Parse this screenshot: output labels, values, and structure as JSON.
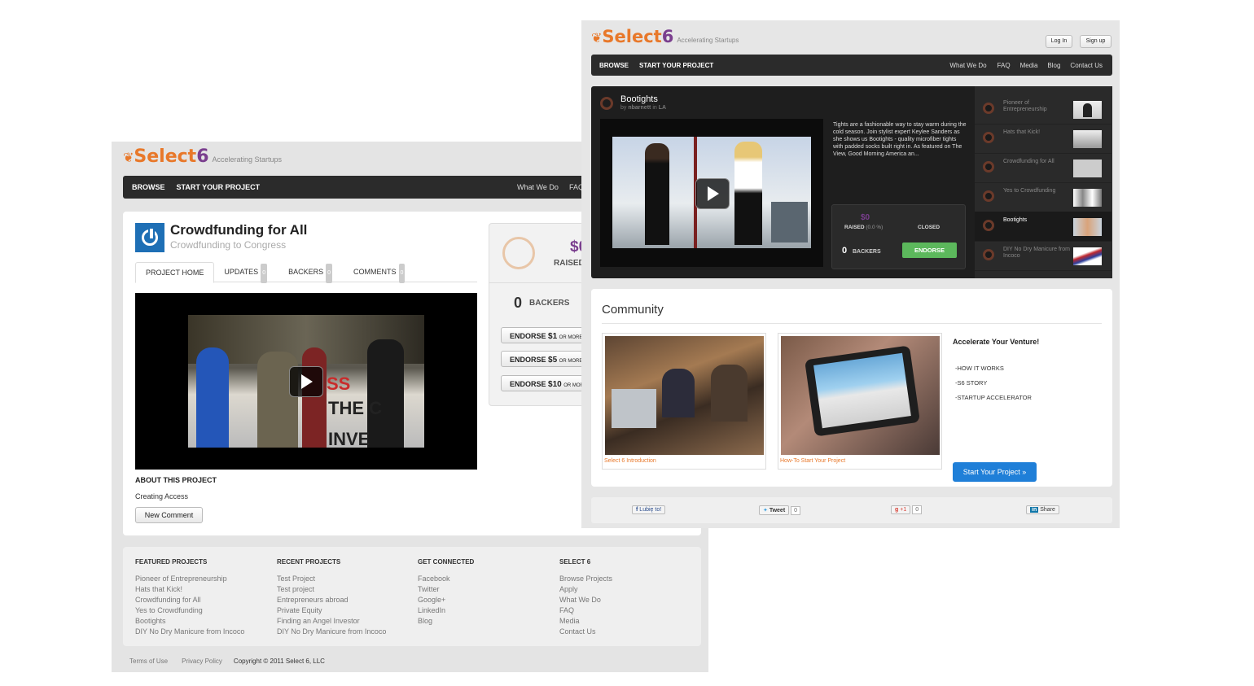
{
  "back": {
    "logo": {
      "name_a": "Select",
      "name_b": "6",
      "tagline": "Accelerating Startups"
    },
    "nav": {
      "browse": "BROWSE",
      "start": "START YOUR PROJECT",
      "what": "What We Do",
      "faq": "FAQ"
    },
    "project": {
      "title": "Crowdfunding for All",
      "subtitle": "Crowdfunding to Congress",
      "tabs": [
        {
          "label": "PROJECT HOME",
          "count": ""
        },
        {
          "label": "UPDATES",
          "count": "0"
        },
        {
          "label": "BACKERS",
          "count": "0"
        },
        {
          "label": "COMMENTS",
          "count": "0"
        }
      ],
      "video_text_a": "SS",
      "video_text_b": "THE C",
      "video_text_c": "INVE",
      "about_heading": "ABOUT THIS PROJECT",
      "about_text": "Creating Access",
      "comment_button": "New Comment"
    },
    "funding": {
      "amount": "$0",
      "raised_label": "RAISED",
      "backers_count": "0",
      "backers_label": "BACKERS",
      "endorse": [
        {
          "label": "ENDORSE",
          "amount": "$1",
          "suffix": "OR MORE"
        },
        {
          "label": "ENDORSE",
          "amount": "$5",
          "suffix": "OR MORE"
        },
        {
          "label": "ENDORSE",
          "amount": "$10",
          "suffix": "OR MORE"
        }
      ]
    },
    "footer": {
      "columns": [
        {
          "heading": "FEATURED PROJECTS",
          "links": [
            "Pioneer of Entrepreneurship",
            "Hats that Kick!",
            "Crowdfunding for All",
            "Yes to Crowdfunding",
            "Bootights",
            "DIY No Dry Manicure from Incoco"
          ]
        },
        {
          "heading": "RECENT PROJECTS",
          "links": [
            "Test Project",
            "Test project",
            "Entrepreneurs abroad",
            "Private Equity",
            "Finding an Angel Investor",
            "DIY No Dry Manicure from Incoco"
          ]
        },
        {
          "heading": "GET CONNECTED",
          "links": [
            "Facebook",
            "Twitter",
            "Google+",
            "LinkedIn",
            "Blog"
          ]
        },
        {
          "heading": "SELECT 6",
          "links": [
            "Browse Projects",
            "Apply",
            "What We Do",
            "FAQ",
            "Media",
            "Contact Us"
          ]
        }
      ],
      "terms": "Terms of Use",
      "privacy": "Privacy Policy",
      "copyright": "Copyright © 2011 Select 6, LLC"
    }
  },
  "front": {
    "logo": {
      "name_a": "Select",
      "name_b": "6",
      "tagline": "Accelerating Startups"
    },
    "login": "Log In",
    "signup": "Sign up",
    "nav": {
      "browse": "BROWSE",
      "start": "START YOUR PROJECT",
      "right": [
        "What We Do",
        "FAQ",
        "Media",
        "Blog",
        "Contact Us"
      ]
    },
    "featured": {
      "title": "Bootights",
      "byline_by": "by",
      "byline_user": "nbarnett",
      "byline_in": "in",
      "byline_loc": "LA",
      "description": "Tights are a fashionable way to stay warm during the cold season. Join stylist expert Keylee Sanders as she shows us Bootights - quality microfiber tights with padded socks built right in. As featured on The View, Good Morning America an...",
      "amount": "$0",
      "raised_label": "RAISED",
      "raised_pct": "(0.0 %)",
      "status": "CLOSED",
      "backers_count": "0",
      "backers_label": "BACKERS",
      "endorse_button": "ENDORSE"
    },
    "side_projects": [
      {
        "title": "Pioneer of Entrepreneurship"
      },
      {
        "title": "Hats that Kick!"
      },
      {
        "title": "Crowdfunding for All"
      },
      {
        "title": "Yes to Crowdfunding"
      },
      {
        "title": "Bootights"
      },
      {
        "title": "DIY No Dry Manicure from Incoco"
      }
    ],
    "community": {
      "heading": "Community",
      "video1_caption": "Select 6 Introduction",
      "video2_caption": "How-To Start Your Project",
      "accelerate_heading": "Accelerate Your Venture!",
      "links": [
        "-HOW IT WORKS",
        "-S6 STORY",
        "-STARTUP ACCELERATOR"
      ],
      "start_button": "Start Your Project »"
    },
    "share": {
      "facebook": "Lubię to!",
      "tweet": "Tweet",
      "tweet_count": "0",
      "gplus": "+1",
      "gplus_count": "0",
      "linkedin": "Share"
    }
  },
  "colors": {
    "accent_orange": "#e8782a",
    "accent_purple": "#7a3e8e",
    "nav_dark": "#2b2b2b",
    "endorse_green": "#5cb85c",
    "start_blue": "#1f7fd8"
  }
}
